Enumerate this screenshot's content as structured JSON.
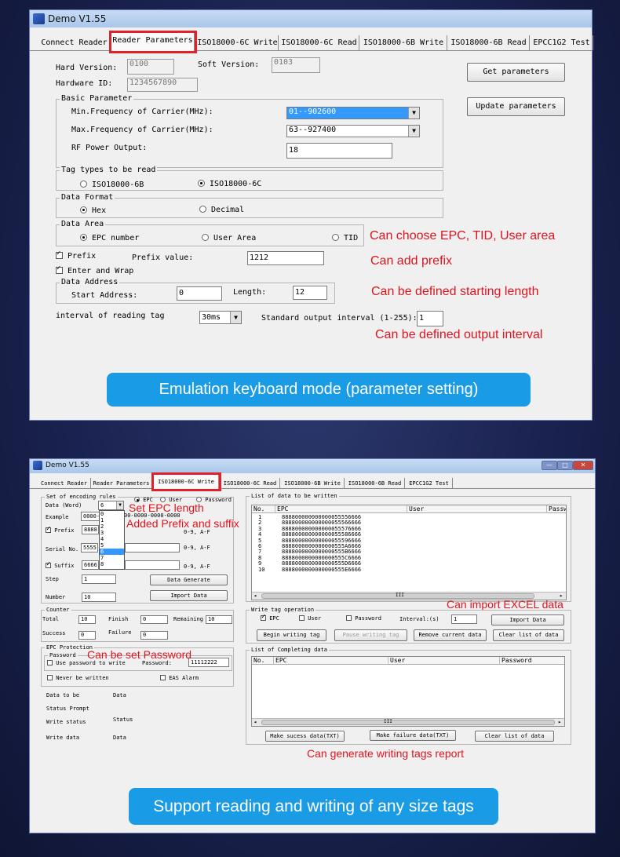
{
  "top": {
    "title": "Demo V1.55",
    "tabs": [
      "Connect Reader",
      "Reader Parameters",
      "ISO18000-6C Write",
      "ISO18000-6C Read",
      "ISO18000-6B Write",
      "ISO18000-6B Read",
      "EPCC1G2 Test"
    ],
    "hard_version_label": "Hard Version:",
    "hard_version": "0100",
    "soft_version_label": "Soft Version:",
    "soft_version": "0103",
    "hardware_id_label": "Hardware ID:",
    "hardware_id": "1234567890",
    "get_params": "Get parameters",
    "update_params": "Update parameters",
    "basic_param": "Basic Parameter",
    "min_freq_label": "Min.Frequency of Carrier(MHz):",
    "min_freq": "01--902600",
    "max_freq_label": "Max.Frequency of Carrier(MHz):",
    "max_freq": "63--927400",
    "rf_power_label": "RF Power Output:",
    "rf_power": "18",
    "tag_types": "Tag types to be read",
    "iso6b": "ISO18000-6B",
    "iso6c": "ISO18000-6C",
    "data_format": "Data Format",
    "hex": "Hex",
    "decimal": "Decimal",
    "data_area": "Data Area",
    "epc_number": "EPC number",
    "user_area": "User Area",
    "tid": "TID",
    "prefix": "Prefix",
    "prefix_value_label": "Prefix value:",
    "prefix_value": "1212",
    "enter_wrap": "Enter and Wrap",
    "data_address": "Data Address",
    "start_addr_label": "Start Address:",
    "start_addr": "0",
    "length_label": "Length:",
    "length": "12",
    "interval_label": "interval of reading tag",
    "interval": "30ms",
    "std_output_label": "Standard output interval (1-255):",
    "std_output": "1",
    "ann_choose": "Can choose EPC, TID, User area",
    "ann_prefix": "Can add prefix",
    "ann_start": "Can be defined starting length",
    "ann_output": "Can be defined output interval",
    "banner": "Emulation keyboard mode (parameter setting)"
  },
  "bottom": {
    "title": "Demo V1.55",
    "tabs": [
      "Connect Reader",
      "Reader Parameters",
      "ISO18000-6C Write",
      "ISO18000-6C Read",
      "ISO18000-6B Write",
      "ISO18000-6B Read",
      "EPCC1G2 Test"
    ],
    "encoding_rules": "Set of encoding rules",
    "data_word_label": "Data (Word)",
    "data_word": "6",
    "r_epc": "EPC",
    "r_user": "User",
    "r_password": "Password",
    "example_label": "Example",
    "example_a": "0000-",
    "example_b": "00-0000-0000-0000",
    "dropdown": [
      "0",
      "1",
      "2",
      "3",
      "4",
      "5",
      "6",
      "7",
      "8"
    ],
    "prefix_label": "Prefix",
    "prefix_val": "8888",
    "hex_hint1": "0-9, A-F",
    "serial_label": "Serial No.",
    "serial_val": "5555",
    "suffix_label": "Suffix",
    "suffix_val": "6666",
    "hex_hint2": "0-9, A-F",
    "step_label": "Step",
    "step_val": "1",
    "data_generate": "Data Generate",
    "number_label": "Number",
    "number_val": "10",
    "import_data": "Import Data",
    "counter": "Counter",
    "total_label": "Total",
    "total_val": "10",
    "finish_label": "Finish",
    "finish_val": "0",
    "remaining_label": "Remaining",
    "remaining_val": "10",
    "success_label": "Success",
    "success_val": "0",
    "failure_label": "Failure",
    "failure_val": "0",
    "epc_protection": "EPC Protection",
    "password_grp": "Password",
    "use_pw": "Use password to write",
    "pw_label": "Password:",
    "pw_val": "11112222",
    "never_written": "Never be written",
    "eas_alarm": "EAS Alarm",
    "data_to_be": "Data to be",
    "data_to_be_val": "Data",
    "status_prompt": "Status Prompt",
    "write_status": "Write status",
    "write_status_val": "Status",
    "write_data": "Write data",
    "write_data_val": "Data",
    "list_title": "List of data to be written",
    "cols": [
      "No.",
      "EPC",
      "User",
      "Password"
    ],
    "rows": [
      {
        "no": "1",
        "epc": "888800000000000055556666"
      },
      {
        "no": "2",
        "epc": "888800000000000055566666"
      },
      {
        "no": "3",
        "epc": "888800000000000055576666"
      },
      {
        "no": "4",
        "epc": "888800000000000055586666"
      },
      {
        "no": "5",
        "epc": "888800000000000055596666"
      },
      {
        "no": "6",
        "epc": "8888000000000000555A6666"
      },
      {
        "no": "7",
        "epc": "8888000000000000555B6666"
      },
      {
        "no": "8",
        "epc": "8888000000000000555C6666"
      },
      {
        "no": "9",
        "epc": "8888000000000000555D6666"
      },
      {
        "no": "10",
        "epc": "8888000000000000555E6666"
      }
    ],
    "scroll_mark": "III",
    "write_op": "Write tag operation",
    "w_epc": "EPC",
    "w_user": "User",
    "w_password": "Password",
    "interval_label": "Interval:(s)",
    "interval_val": "1",
    "import_data2": "Import Data",
    "begin_writing": "Begin writing tag",
    "pause_writing": "Pause writing tag",
    "remove_current": "Remove current data",
    "clear_list": "Clear list of data",
    "completing_title": "List of Completing data",
    "make_success": "Make sucess data(TXT)",
    "make_failure": "Make failure data(TXT)",
    "clear_list2": "Clear list of data",
    "ann_epc_len": "Set EPC length",
    "ann_prefix_suffix": "Added Prefix and suffix",
    "ann_excel": "Can import EXCEL data",
    "ann_password": "Can be set Password",
    "ann_report": "Can generate writing tags report",
    "banner": "Support reading and writing of any size tags"
  }
}
